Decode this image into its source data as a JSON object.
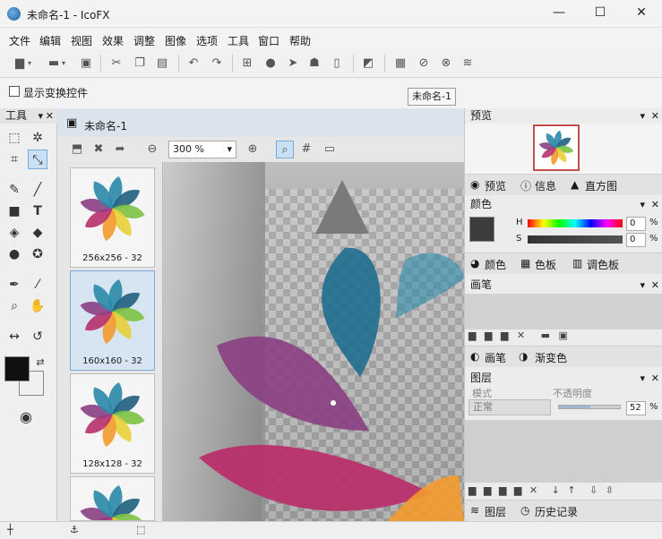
{
  "window": {
    "title": "未命名-1 - IcoFX",
    "minimize": "—",
    "maximize": "☐",
    "close": "✕"
  },
  "menu": [
    "文件",
    "编辑",
    "视图",
    "效果",
    "调整",
    "图像",
    "选项",
    "工具",
    "窗口",
    "帮助"
  ],
  "options": {
    "show_transform_label": "显示变换控件"
  },
  "tooltip": "未命名-1",
  "tools_panel": {
    "title": "工具"
  },
  "document": {
    "tab_title": "未命名-1",
    "zoom": "300 %",
    "thumbnails": [
      {
        "caption": "256x256 - 32"
      },
      {
        "caption": "160x160 - 32"
      },
      {
        "caption": "128x128 - 32"
      },
      {
        "caption": ""
      }
    ]
  },
  "preview": {
    "title": "预览",
    "tabs": [
      "预览",
      "信息",
      "直方图"
    ]
  },
  "color": {
    "title": "颜色",
    "h_label": "H",
    "s_label": "S",
    "h_value": "0",
    "s_value": "0",
    "pct": "%",
    "tabs": [
      "颜色",
      "色板",
      "调色板"
    ]
  },
  "brush": {
    "title": "画笔",
    "tabs": [
      "画笔",
      "渐变色"
    ]
  },
  "layers": {
    "title": "图层",
    "mode_label": "模式",
    "opacity_label": "不透明度",
    "mode_value": "正常",
    "opacity_value": "52",
    "pct": "%",
    "opacity": 0.52,
    "tabs": [
      "图层",
      "历史记录"
    ]
  },
  "colors": {
    "teal": "#2a8aa8",
    "purple": "#8b3f83",
    "magenta": "#b8306c",
    "green": "#7dc242",
    "orange": "#f39a2c",
    "yellow": "#e8d03a",
    "dark_teal": "#1f5f80"
  }
}
